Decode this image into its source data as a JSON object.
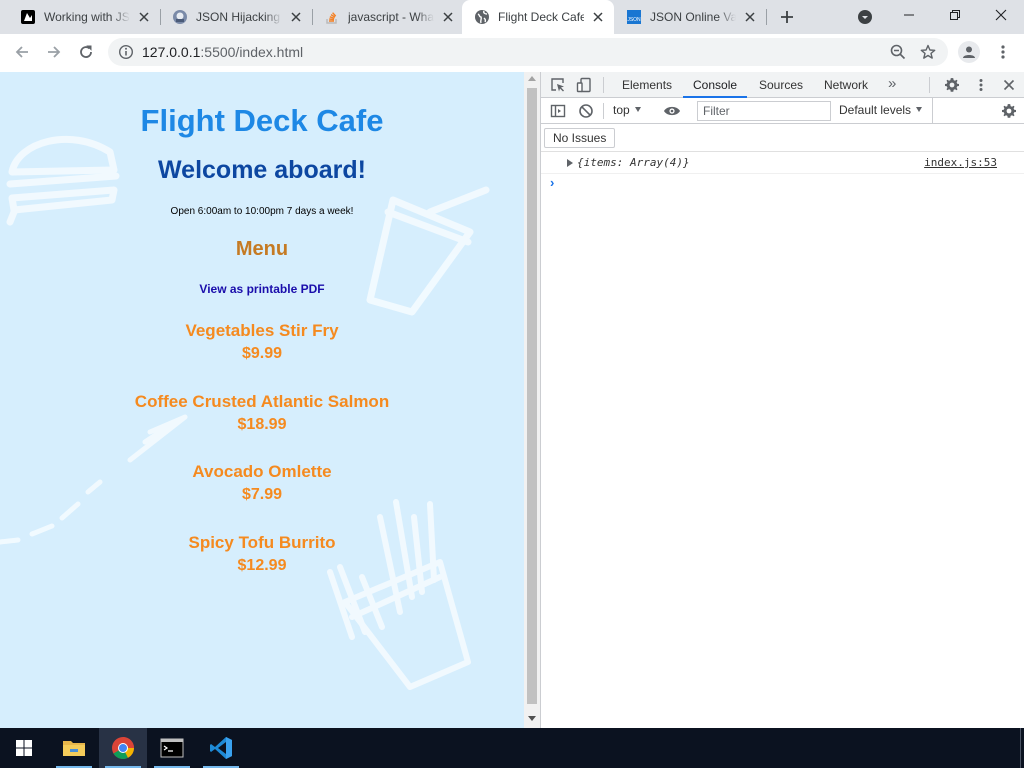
{
  "browser": {
    "tabs": [
      {
        "title": "Working with JSON - Learn web development | MDN",
        "favicon": "mdn-icon",
        "active": false
      },
      {
        "title": "JSON Hijacking | You've Been Haacked",
        "favicon": "blog-icon",
        "active": false
      },
      {
        "title": "javascript - What is JSON and why would I use it?",
        "favicon": "stackoverflow-icon",
        "active": false
      },
      {
        "title": "Flight Deck Cafe",
        "favicon": "globe-icon",
        "active": true
      },
      {
        "title": "JSON Online Validator and Formatter",
        "favicon": "json-icon",
        "active": false
      }
    ],
    "url_host": "127.0.0.1",
    "url_rest": ":5500/index.html"
  },
  "page": {
    "title": "Flight Deck Cafe",
    "welcome": "Welcome aboard!",
    "hours": "Open 6:00am to 10:00pm 7 days a week!",
    "menu_heading": "Menu",
    "pdf_link": "View as printable PDF",
    "items": [
      {
        "name": "Vegetables Stir Fry",
        "price": "$9.99"
      },
      {
        "name": "Coffee Crusted Atlantic Salmon",
        "price": "$18.99"
      },
      {
        "name": "Avocado Omlette",
        "price": "$7.99"
      },
      {
        "name": "Spicy Tofu Burrito",
        "price": "$12.99"
      }
    ]
  },
  "devtools": {
    "tabs": [
      "Elements",
      "Console",
      "Sources",
      "Network"
    ],
    "active_tab": "Console",
    "context": "top",
    "filter_placeholder": "Filter",
    "levels": "Default levels",
    "issues": "No Issues",
    "log_text": "{items: Array(4)}",
    "log_source": "index.js:53",
    "prompt": "›"
  },
  "colors": {
    "page_bg": "#d6eefd",
    "title": "#1e88e5",
    "welcome": "#0d47a1",
    "menu_heading": "#c57a23",
    "item": "#f58a1f",
    "link": "#1a0dab"
  }
}
